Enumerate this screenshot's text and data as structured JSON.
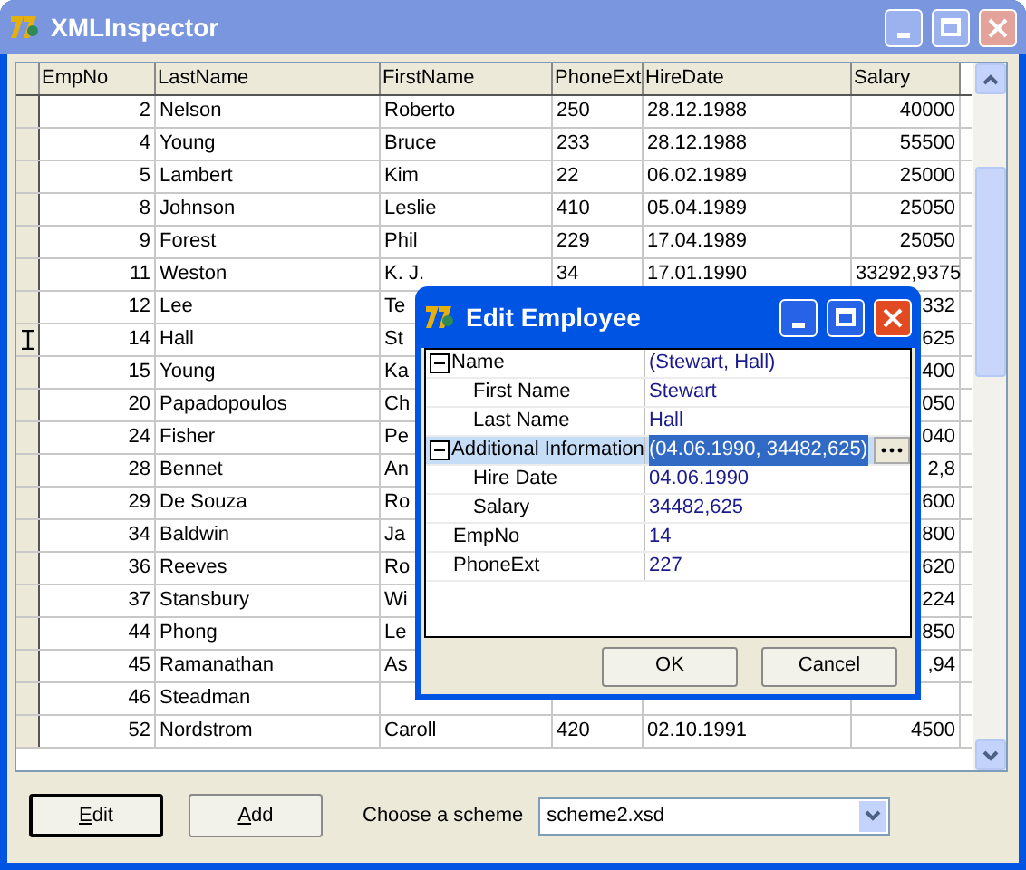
{
  "window": {
    "title": "XMLInspector"
  },
  "grid": {
    "columns": [
      "EmpNo",
      "LastName",
      "FirstName",
      "PhoneExt",
      "HireDate",
      "Salary"
    ],
    "rows": [
      {
        "cells": [
          "2",
          "Nelson",
          "Roberto",
          "250",
          "28.12.1988",
          "40000"
        ],
        "current": false
      },
      {
        "cells": [
          "4",
          "Young",
          "Bruce",
          "233",
          "28.12.1988",
          "55500"
        ],
        "current": false
      },
      {
        "cells": [
          "5",
          "Lambert",
          "Kim",
          "22",
          "06.02.1989",
          "25000"
        ],
        "current": false
      },
      {
        "cells": [
          "8",
          "Johnson",
          "Leslie",
          "410",
          "05.04.1989",
          "25050"
        ],
        "current": false
      },
      {
        "cells": [
          "9",
          "Forest",
          "Phil",
          "229",
          "17.04.1989",
          "25050"
        ],
        "current": false
      },
      {
        "cells": [
          "11",
          "Weston",
          "K. J.",
          "34",
          "17.01.1990",
          "33292,9375"
        ],
        "current": false
      },
      {
        "cells": [
          "12",
          "Lee",
          "Te",
          null,
          null,
          "332"
        ],
        "current": false
      },
      {
        "cells": [
          "14",
          "Hall",
          "St",
          null,
          null,
          "625"
        ],
        "current": true
      },
      {
        "cells": [
          "15",
          "Young",
          "Ka",
          null,
          null,
          "400"
        ],
        "current": false
      },
      {
        "cells": [
          "20",
          "Papadopoulos",
          "Ch",
          null,
          null,
          "050"
        ],
        "current": false
      },
      {
        "cells": [
          "24",
          "Fisher",
          "Pe",
          null,
          null,
          "040"
        ],
        "current": false
      },
      {
        "cells": [
          "28",
          "Bennet",
          "An",
          null,
          null,
          "2,8"
        ],
        "current": false
      },
      {
        "cells": [
          "29",
          "De Souza",
          "Ro",
          null,
          null,
          "600"
        ],
        "current": false
      },
      {
        "cells": [
          "34",
          "Baldwin",
          "Ja",
          null,
          null,
          "800"
        ],
        "current": false
      },
      {
        "cells": [
          "36",
          "Reeves",
          "Ro",
          null,
          null,
          "620"
        ],
        "current": false
      },
      {
        "cells": [
          "37",
          "Stansbury",
          "Wi",
          null,
          null,
          "224"
        ],
        "current": false
      },
      {
        "cells": [
          "44",
          "Phong",
          "Le",
          null,
          null,
          "850"
        ],
        "current": false
      },
      {
        "cells": [
          "45",
          "Ramanathan",
          "As",
          null,
          null,
          ",94"
        ],
        "current": false
      },
      {
        "cells": [
          "46",
          "Steadman",
          null,
          null,
          null,
          null
        ],
        "current": false
      },
      {
        "cells": [
          "52",
          "Nordstrom",
          "Caroll",
          "420",
          "02.10.1991",
          "4500"
        ],
        "current": false
      }
    ]
  },
  "dialog": {
    "title": "Edit Employee",
    "properties": [
      {
        "label": "Name",
        "value": "(Stewart, Hall)",
        "expanded": true,
        "selected": false,
        "children": [
          {
            "label": "First Name",
            "value": "Stewart",
            "selected": false
          },
          {
            "label": "Last Name",
            "value": "Hall",
            "selected": false
          }
        ]
      },
      {
        "label": "Additional Information",
        "value": "(04.06.1990, 34482,625)",
        "expanded": true,
        "selected": true,
        "children": [
          {
            "label": "Hire Date",
            "value": "04.06.1990",
            "selected": false
          },
          {
            "label": "Salary",
            "value": "34482,625",
            "selected": false
          }
        ]
      },
      {
        "label": "EmpNo",
        "value": "14",
        "selected": false
      },
      {
        "label": "PhoneExt",
        "value": "227",
        "selected": false
      }
    ],
    "buttons": [
      "OK",
      "Cancel"
    ]
  },
  "buttons": [
    {
      "label": "Edit",
      "underline_first": true,
      "default": true
    },
    {
      "label": "Add",
      "underline_first": true,
      "default": false
    }
  ],
  "scheme": {
    "label": "Choose a scheme",
    "value": "scheme2.xsd"
  }
}
